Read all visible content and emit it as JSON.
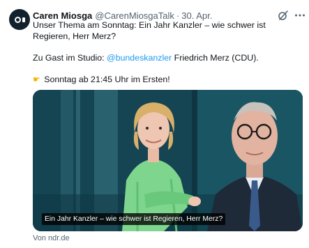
{
  "author": {
    "display_name": "Caren Miosga",
    "handle": "@CarenMiosgaTalk",
    "separator": "·",
    "date": "30. Apr."
  },
  "tweet": {
    "line1": "Unser Thema am Sonntag: Ein Jahr Kanzler – wie schwer ist Regieren, Herr Merz?",
    "guest_prefix": "Zu Gast im Studio: ",
    "mention": "@bundeskanzler",
    "guest_suffix": " Friedrich Merz (CDU).",
    "time_text": "Sonntag ab 21:45 Uhr im Ersten!"
  },
  "icons": {
    "avatar": "avatar-logo-icon",
    "grok": "grok-icon",
    "more": "more-dots-icon",
    "pointing": "pointing-hand-icon"
  },
  "media": {
    "caption": "Ein Jahr Kanzler – wie schwer ist Regieren, Herr Merz?"
  },
  "link_source": "Von ndr.de",
  "colors": {
    "link": "#1d9bf0",
    "secondary_text": "#536471",
    "primary_text": "#0f1419"
  }
}
